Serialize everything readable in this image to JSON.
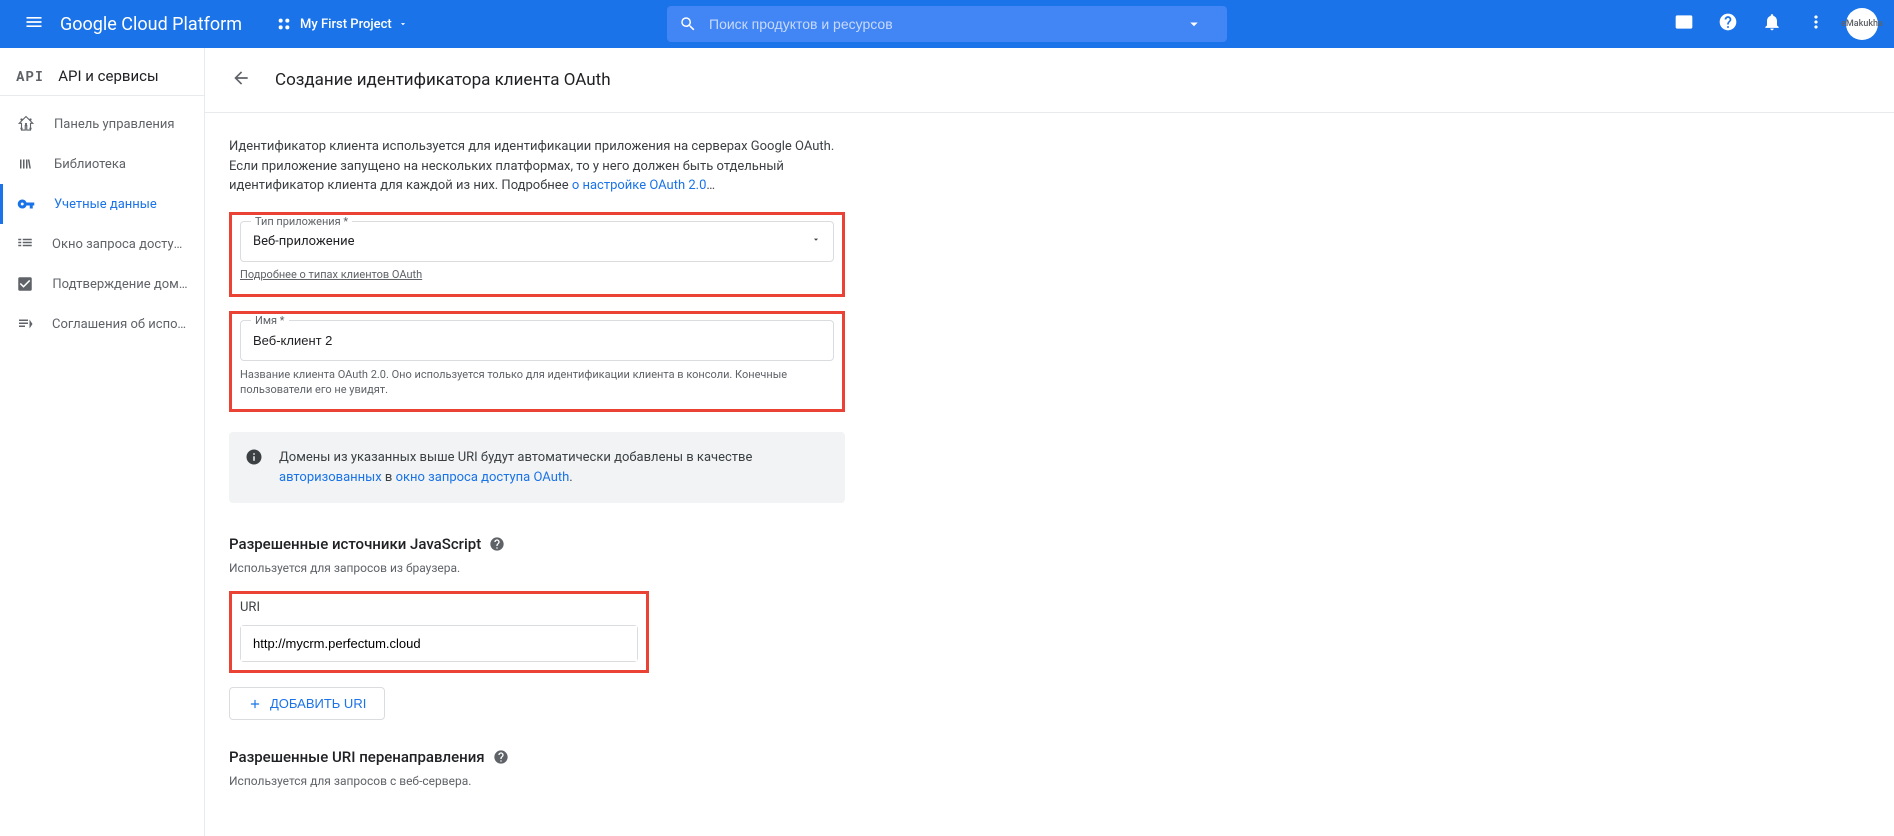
{
  "header": {
    "logo": "Google Cloud Platform",
    "project_name": "My First Project",
    "search_placeholder": "Поиск продуктов и ресурсов",
    "avatar_text": "eMakukha"
  },
  "sidebar": {
    "section_title": "API и сервисы",
    "items": [
      {
        "label": "Панель управления"
      },
      {
        "label": "Библиотека"
      },
      {
        "label": "Учетные данные"
      },
      {
        "label": "Окно запроса доступа OAu..."
      },
      {
        "label": "Подтверждение домена"
      },
      {
        "label": "Соглашения об использов..."
      }
    ]
  },
  "main": {
    "page_title": "Создание идентификатора клиента OAuth",
    "intro_prefix": "Идентификатор клиента используется для идентификации приложения на серверах Google OAuth. Если приложение запущено на нескольких платформах, то у него должен быть отдельный идентификатор клиента для каждой из них. Подробнее ",
    "intro_link": "о настройке OAuth 2.0",
    "intro_suffix": "…",
    "app_type": {
      "label": "Тип приложения *",
      "value": "Веб-приложение",
      "helper_link": "Подробнее о типах клиентов OAuth"
    },
    "name_field": {
      "label": "Имя *",
      "value": "Веб-клиент 2",
      "helper": "Название клиента OAuth 2.0. Оно используется только для идентификации клиента в консоли. Конечные пользователи его не увидят."
    },
    "banner": {
      "prefix": "Домены из указанных выше URI будут автоматически добавлены в качестве ",
      "link1": "авторизованных",
      "mid": " в ",
      "link2": "окно запроса доступа OAuth",
      "suffix": "."
    },
    "js_origins": {
      "title": "Разрешенные источники JavaScript",
      "desc": "Используется для запросов из браузера.",
      "uri_label": "URI",
      "uri_value": "http://mycrm.perfectum.cloud",
      "add_button": "ДОБАВИТЬ URI"
    },
    "redirect_uris": {
      "title": "Разрешенные URI перенаправления",
      "desc": "Используется для запросов с веб-сервера."
    }
  }
}
